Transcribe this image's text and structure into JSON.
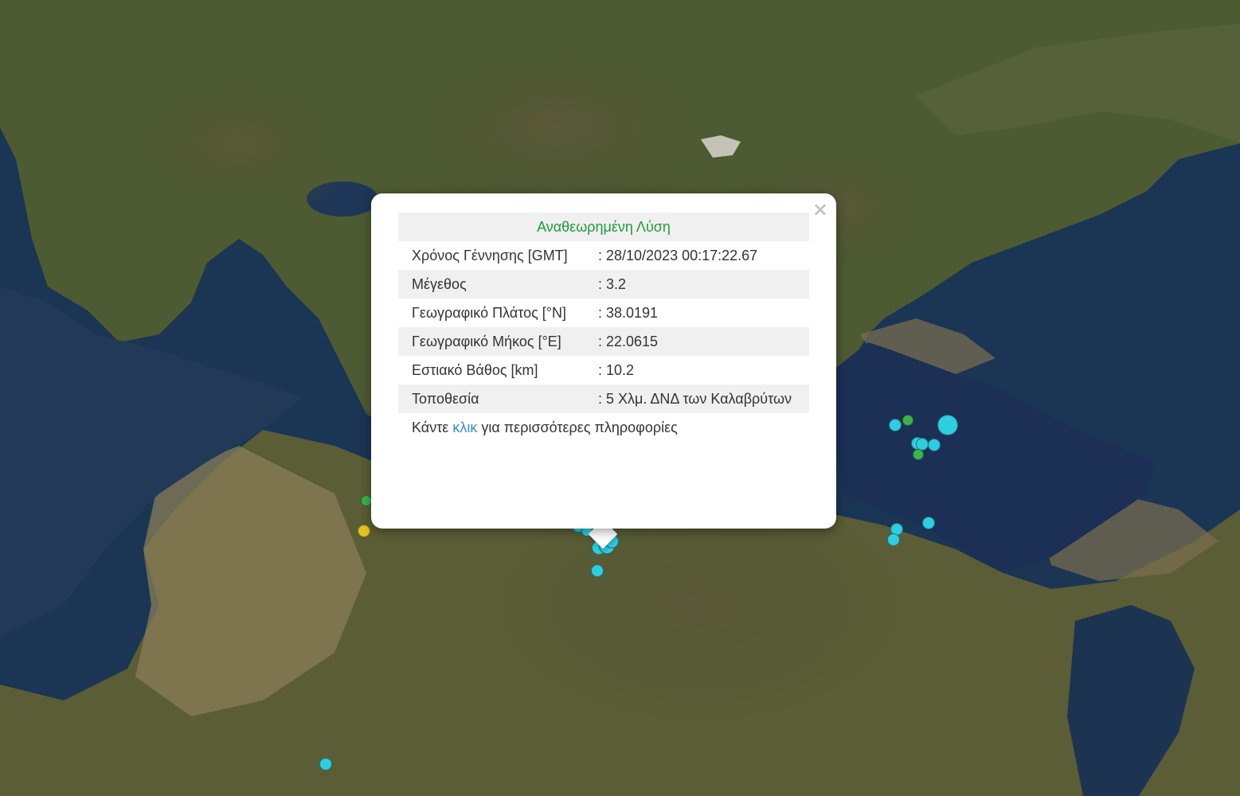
{
  "map": {
    "base_colors": {
      "sea": "#1b3554",
      "land": "#4d5b32",
      "mountain": "#3f4028",
      "plain": "#7a6e4d"
    },
    "markers": [
      {
        "lat_color": "#2fcde0",
        "id": 1
      },
      {
        "lat_color": "#2fcde0",
        "id": 2
      }
    ]
  },
  "popup": {
    "header": "Αναθεωρημένη Λύση",
    "rows": [
      {
        "label": "Χρόνος Γέννησης [GMT]",
        "value": ": 28/10/2023 00:17:22.67"
      },
      {
        "label": "Μέγεθος",
        "value": ": 3.2"
      },
      {
        "label": "Γεωγραφικό Πλάτος [°N]",
        "value": ": 38.0191"
      },
      {
        "label": "Γεωγραφικό Μήκος [°E]",
        "value": ": 22.0615"
      },
      {
        "label": "Εστιακό Βάθος [km]",
        "value": ": 10.2"
      },
      {
        "label": "Τοποθεσία",
        "value": ": 5 Χλμ. ΔΝΔ των Καλαβρύτων"
      }
    ],
    "footer_prefix": "Κάντε",
    "footer_link": "κλικ",
    "footer_suffix": "για περισσότερες πληροφορίες",
    "close_symbol": "×",
    "colors": {
      "header": "#1f9b3c",
      "link": "#2f8ec9"
    }
  }
}
